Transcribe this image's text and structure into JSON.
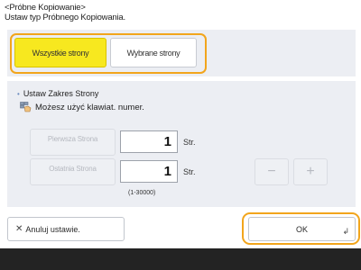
{
  "header": {
    "title": "<Próbne Kopiowanie>",
    "subtitle": "Ustaw typ Próbnego Kopiowania."
  },
  "mode": {
    "all_pages": "Wszystkie strony",
    "selected_pages": "Wybrane strony",
    "selected": "all_pages"
  },
  "range_section": {
    "title": "Ustaw Zakres Strony",
    "hint": "Możesz użyć klawiat. numer.",
    "first_page_label": "Pierwsza Strona",
    "first_page_value": "1",
    "last_page_label": "Ostatnia Strona",
    "last_page_value": "1",
    "unit": "Str.",
    "range_note": "(1-30000)",
    "minus": "−",
    "plus": "+"
  },
  "footer": {
    "cancel_label": "Anuluj ustawie.",
    "ok_label": "OK"
  },
  "colors": {
    "highlight": "#f2a51c",
    "selected_fill": "#f7e81f",
    "panel": "#eceef3",
    "bottom_bar": "#232323"
  }
}
